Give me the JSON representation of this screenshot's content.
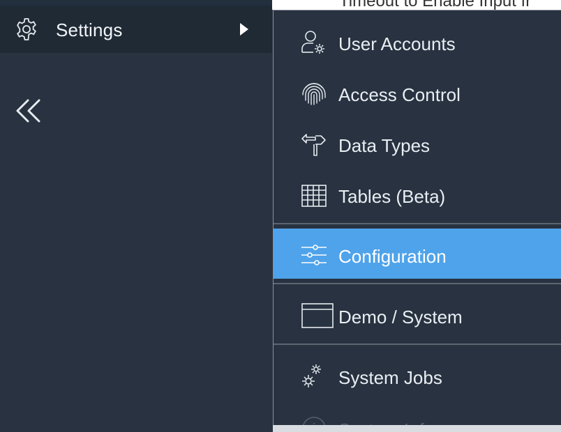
{
  "sidebar": {
    "settings_label": "Settings",
    "icons": {
      "settings": "gear-icon",
      "submenu": "caret-right-icon",
      "collapse": "double-chevron-left-icon"
    }
  },
  "background": {
    "partial_text": "Timeout to Enable Input fr"
  },
  "flyout": {
    "items": [
      {
        "label": "User Accounts",
        "icon": "user-gear-icon"
      },
      {
        "label": "Access Control",
        "icon": "fingerprint-icon"
      },
      {
        "label": "Data Types",
        "icon": "signpost-icon"
      },
      {
        "label": "Tables (Beta)",
        "icon": "table-grid-icon"
      },
      {
        "label": "Configuration",
        "icon": "sliders-icon",
        "active": true
      },
      {
        "label": "Demo / System",
        "icon": "window-icon"
      },
      {
        "label": "System Jobs",
        "icon": "gears-icon"
      },
      {
        "label": "System Info",
        "icon": "info-icon"
      }
    ]
  },
  "colors": {
    "sidebar_bg": "#283240",
    "settings_row_bg": "#202a35",
    "active_item_bg": "#4fa3ea",
    "divider": "#5d6670",
    "text": "#e9eef3"
  }
}
